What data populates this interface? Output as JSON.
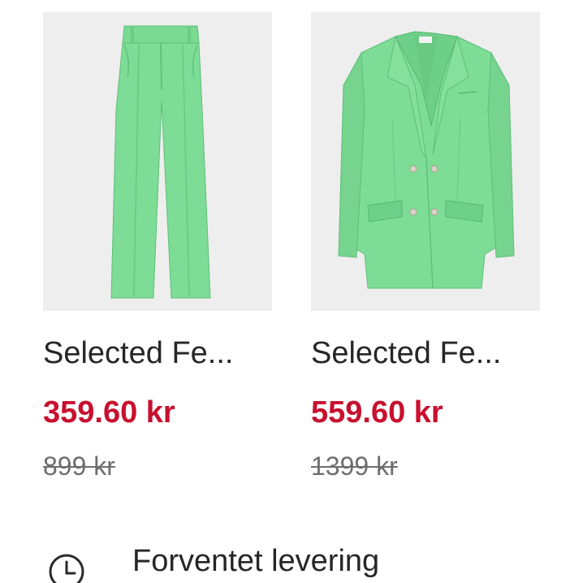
{
  "products": [
    {
      "title": "Selected Fe...",
      "price": "359.60 kr",
      "original_price": "899 kr",
      "image": "green-wide-leg-trousers",
      "garment_color": "#7ddc95"
    },
    {
      "title": "Selected Fe...",
      "price": "559.60 kr",
      "original_price": "1399 kr",
      "image": "green-double-breasted-blazer",
      "garment_color": "#7ddc95"
    }
  ],
  "delivery": {
    "label": "Forventet levering",
    "icon": "clock-icon"
  },
  "colors": {
    "sale_price": "#c8102e",
    "thumbnail_bg": "#eeeeee"
  }
}
